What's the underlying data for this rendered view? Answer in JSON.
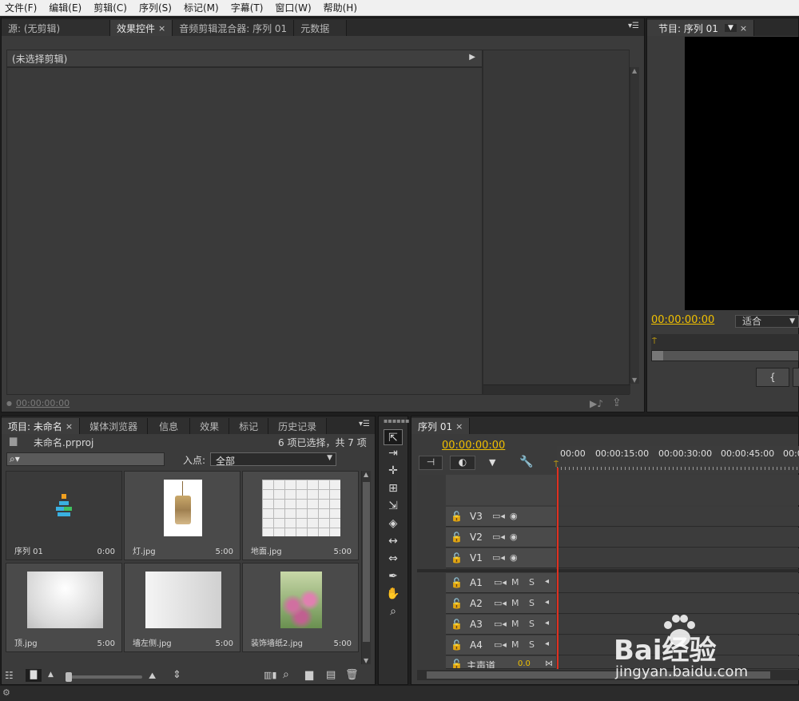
{
  "menu": [
    "文件(F)",
    "编辑(E)",
    "剪辑(C)",
    "序列(S)",
    "标记(M)",
    "字幕(T)",
    "窗口(W)",
    "帮助(H)"
  ],
  "top_left_panel": {
    "tabs": [
      {
        "label": "源: (无剪辑)",
        "active": false,
        "close": ""
      },
      {
        "label": "效果控件",
        "active": true,
        "close": "×"
      },
      {
        "label": "音频剪辑混合器: 序列 01",
        "active": false,
        "close": ""
      },
      {
        "label": "元数据",
        "active": false,
        "close": ""
      }
    ],
    "header_label": "(未选择剪辑)",
    "timecode": "00:00:00:00"
  },
  "program_monitor": {
    "tab_label": "节目: 序列 01",
    "timecode": "00:00:00:00",
    "zoom": "适合",
    "mark_in_icon": "{"
  },
  "project_panel": {
    "tabs": [
      {
        "label": "项目: 未命名",
        "active": true,
        "close": "×"
      },
      {
        "label": "媒体浏览器",
        "active": false,
        "close": ""
      },
      {
        "label": "信息",
        "active": false,
        "close": ""
      },
      {
        "label": "效果",
        "active": false,
        "close": ""
      },
      {
        "label": "标记",
        "active": false,
        "close": ""
      },
      {
        "label": "历史记录",
        "active": false,
        "close": ""
      }
    ],
    "project_file": "未命名.prproj",
    "selection_status": "6 项已选择，共 7 项",
    "search_placeholder": "",
    "inpoint_label": "入点:",
    "inpoint_value": "全部",
    "items": [
      {
        "name": "序列 01",
        "duration": "0:00"
      },
      {
        "name": "灯.jpg",
        "duration": "5:00"
      },
      {
        "name": "地面.jpg",
        "duration": "5:00"
      },
      {
        "name": "顶.jpg",
        "duration": "5:00"
      },
      {
        "name": "墙左侧.jpg",
        "duration": "5:00"
      },
      {
        "name": "装饰墙纸2.jpg",
        "duration": "5:00"
      }
    ]
  },
  "timeline": {
    "tab_label": "序列 01",
    "timecode": "00:00:00:00",
    "ruler": [
      "00:00",
      "00:00:15:00",
      "00:00:30:00",
      "00:00:45:00",
      "00:0"
    ],
    "video_tracks": [
      "V3",
      "V2",
      "V1"
    ],
    "audio_tracks": [
      "A1",
      "A2",
      "A3",
      "A4"
    ],
    "master_label": "主声道",
    "master_value": "0.0",
    "audio_m": "M",
    "audio_s": "S"
  },
  "watermark": {
    "brand": "Bai经验",
    "url": "jingyan.baidu.com"
  },
  "colors": {
    "timecode": "#f0c000",
    "playhead": "#e03020",
    "panel_bg": "#3b3b3b"
  }
}
